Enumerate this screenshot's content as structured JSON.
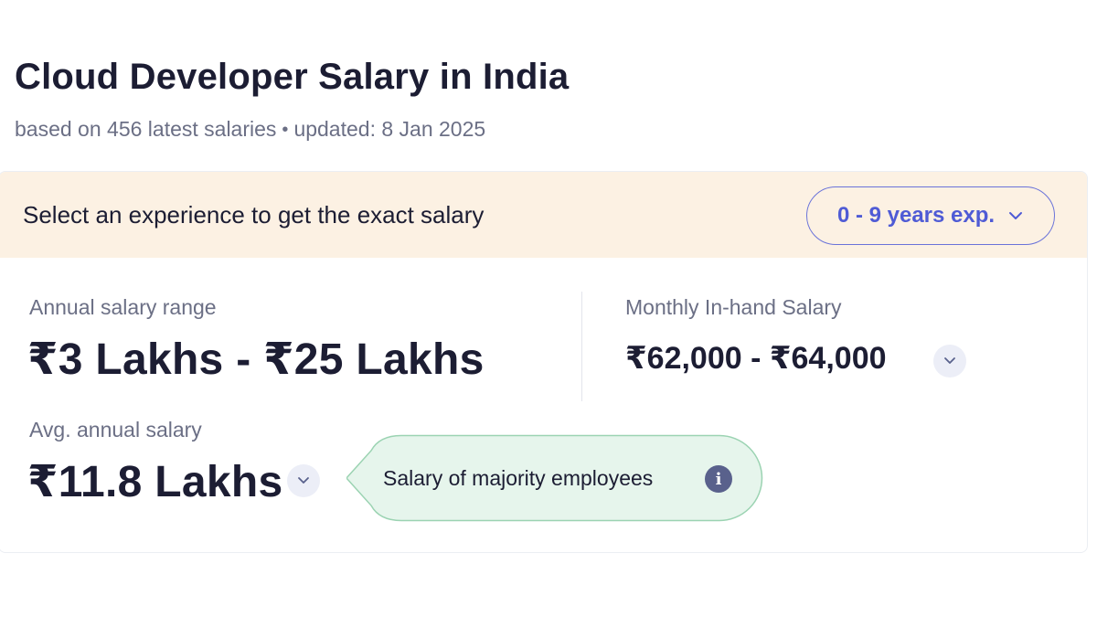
{
  "header": {
    "title": "Cloud Developer Salary in India",
    "subtitle_count": "based on 456 latest salaries",
    "subtitle_separator": "•",
    "subtitle_updated": "updated: 8 Jan 2025"
  },
  "experience": {
    "prompt": "Select an experience to get the exact salary",
    "selected": "0 - 9 years exp."
  },
  "annual": {
    "label": "Annual salary range",
    "value": "₹3 Lakhs - ₹25 Lakhs"
  },
  "monthly": {
    "label": "Monthly In-hand Salary",
    "value": "₹62,000 - ₹64,000"
  },
  "average": {
    "label": "Avg. annual salary",
    "value": "₹11.8 Lakhs"
  },
  "tooltip": {
    "text": "Salary of majority employees",
    "icon": "info-icon"
  },
  "colors": {
    "accent": "#4f5bd5",
    "banner_bg": "#fcf1e3",
    "tooltip_bg": "#e6f5ec",
    "tooltip_border": "#9bd3b2"
  }
}
